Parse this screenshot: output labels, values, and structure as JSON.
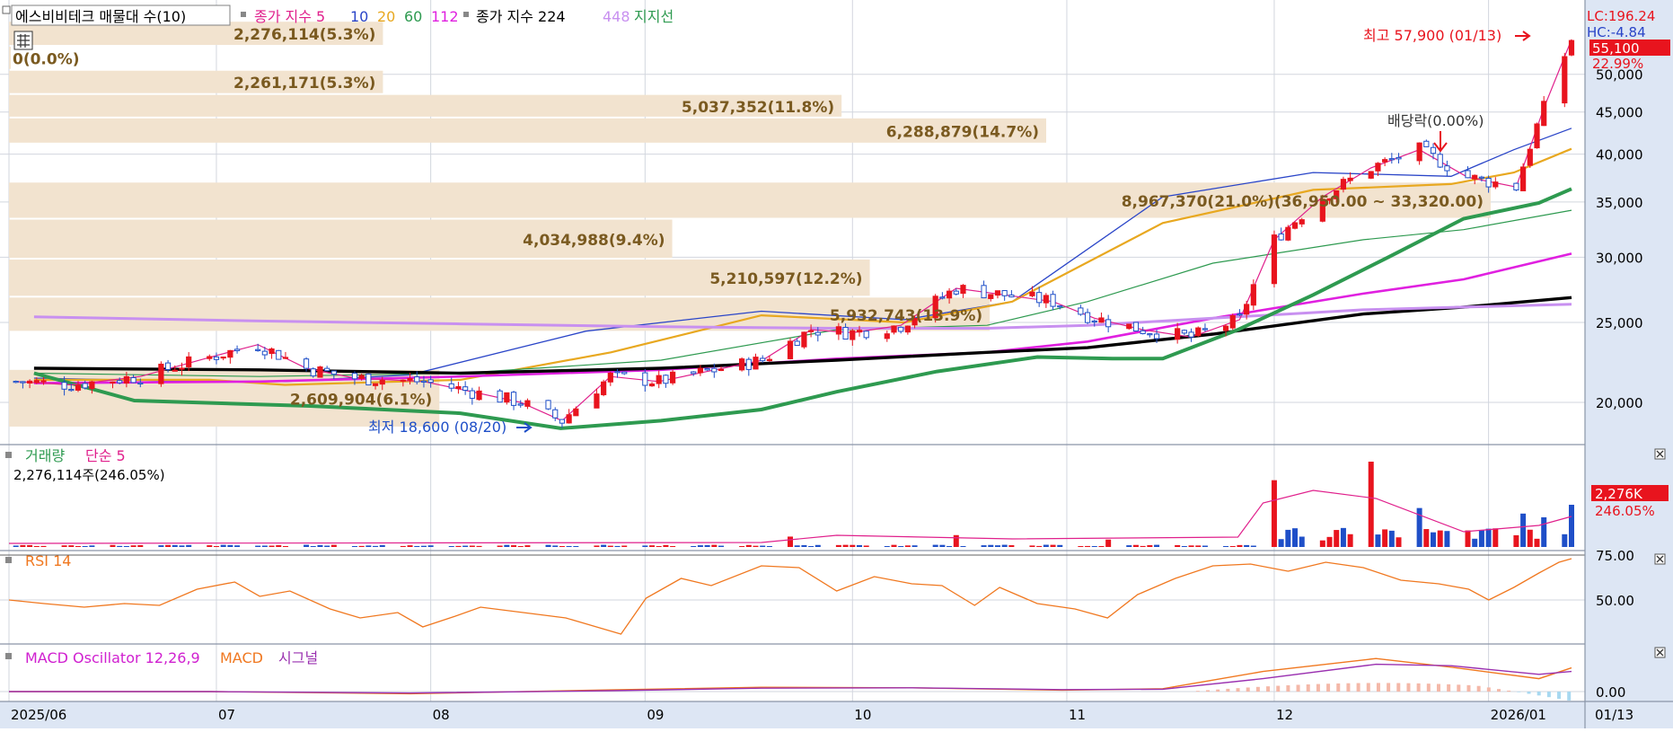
{
  "legend": {
    "title": "에스비비테크 매물대 수(10)",
    "ma_label": "종가 지수 5",
    "ma_periods": [
      "10",
      "20",
      "60",
      "112"
    ],
    "long_ma_label": "종가 지수 224",
    "long_ma_448": "448",
    "support_label": "지지선"
  },
  "indicators": {
    "lc": "LC:196.24",
    "hc": "HC:-4.84",
    "price_badge": "55,100",
    "pct_badge": "22.99%",
    "high_label": "최고 57,900 (01/13)",
    "low_label": "최저 18,600 (08/20)",
    "dividend_label": "배당락(0.00%)",
    "volume_title": "거래량",
    "volume_ma": "단순 5",
    "volume_value": "2,276,114주(246.05%)",
    "volume_badge": "2,276K",
    "volume_pct_badge": "246.05%",
    "rsi_title": "RSI 14",
    "macd_title": "MACD Oscillator 12,26,9",
    "macd_label": "MACD",
    "signal_label": "시그널",
    "last_date": "01/13"
  },
  "colors": {
    "up": "#e8141e",
    "down": "#1f4fc8",
    "ma5": "#e0208c",
    "ma10": "#2a45c8",
    "ma20": "#e8a820",
    "ma60": "#2e9a50",
    "ma112": "#e020e0",
    "ma224": "#000000",
    "ma448": "#c890f0",
    "support": "#2e9a50",
    "profile": "#f2e3cf",
    "profile_text": "#7a5a20",
    "rsi": "#f07820",
    "macd": "#f07820",
    "signal": "#9a30b0",
    "grid": "#d2d6de"
  },
  "chart_data": [
    {
      "type": "candlestick",
      "title": "에스비비테크 매물대 수(10)",
      "ylim": [
        18000,
        60000
      ],
      "y_scale": "log",
      "y_ticks": [
        "50,000",
        "45,000",
        "40,000",
        "35,000",
        "30,000",
        "25,000",
        "20,000"
      ],
      "x_ticks": [
        "2025/06",
        "07",
        "08",
        "09",
        "10",
        "11",
        "12",
        "2026/01",
        "01/13"
      ],
      "x_range": [
        "2025-06-01",
        "2026-01-13"
      ],
      "grid": true,
      "close_series": [
        [
          "2025-06-02",
          21200
        ],
        [
          "2025-06-10",
          21000
        ],
        [
          "2025-06-20",
          21500
        ],
        [
          "2025-07-01",
          22800
        ],
        [
          "2025-07-07",
          23500
        ],
        [
          "2025-07-14",
          22000
        ],
        [
          "2025-07-21",
          21400
        ],
        [
          "2025-07-31",
          21200
        ],
        [
          "2025-08-07",
          20600
        ],
        [
          "2025-08-14",
          20000
        ],
        [
          "2025-08-20",
          19000
        ],
        [
          "2025-08-27",
          21500
        ],
        [
          "2025-09-03",
          21200
        ],
        [
          "2025-09-10",
          21800
        ],
        [
          "2025-09-18",
          22500
        ],
        [
          "2025-09-25",
          24500
        ],
        [
          "2025-10-01",
          24300
        ],
        [
          "2025-10-08",
          24800
        ],
        [
          "2025-10-16",
          27500
        ],
        [
          "2025-10-23",
          27000
        ],
        [
          "2025-10-30",
          26500
        ],
        [
          "2025-11-05",
          25300
        ],
        [
          "2025-11-12",
          24500
        ],
        [
          "2025-11-19",
          24000
        ],
        [
          "2025-11-26",
          25200
        ],
        [
          "2025-12-01",
          31500
        ],
        [
          "2025-12-08",
          35500
        ],
        [
          "2025-12-15",
          38500
        ],
        [
          "2025-12-22",
          40500
        ],
        [
          "2025-12-29",
          37500
        ],
        [
          "2026-01-05",
          36500
        ],
        [
          "2026-01-09",
          45500
        ],
        [
          "2026-01-13",
          55100
        ]
      ],
      "moving_averages": [
        {
          "name": "10",
          "values": [
            [
              10,
              21400
            ],
            [
              80,
              21200
            ],
            [
              110,
              21200
            ],
            [
              160,
              21600
            ],
            [
              230,
              24400
            ],
            [
              300,
              25800
            ],
            [
              357,
              25200
            ],
            [
              400,
              26500
            ],
            [
              460,
              35500
            ],
            [
              520,
              38000
            ],
            [
              575,
              37600
            ],
            [
              600,
              40500
            ],
            [
              623,
              43000
            ]
          ]
        },
        {
          "name": "20",
          "values": [
            [
              10,
              21300
            ],
            [
              80,
              21300
            ],
            [
              110,
              21000
            ],
            [
              180,
              21300
            ],
            [
              240,
              23000
            ],
            [
              300,
              25500
            ],
            [
              357,
              25000
            ],
            [
              400,
              26500
            ],
            [
              460,
              33000
            ],
            [
              520,
              36200
            ],
            [
              575,
              36800
            ],
            [
              600,
              38000
            ],
            [
              623,
              40600
            ]
          ]
        },
        {
          "name": "60",
          "values": [
            [
              10,
              21700
            ],
            [
              100,
              21500
            ],
            [
              180,
              21700
            ],
            [
              260,
              22500
            ],
            [
              330,
              24500
            ],
            [
              390,
              24800
            ],
            [
              430,
              26500
            ],
            [
              480,
              29500
            ],
            [
              540,
              31500
            ],
            [
              580,
              32400
            ],
            [
              623,
              34200
            ]
          ]
        },
        {
          "name": "112",
          "values": [
            [
              10,
              21100
            ],
            [
              100,
              21200
            ],
            [
              180,
              21500
            ],
            [
              260,
              21900
            ],
            [
              330,
              22600
            ],
            [
              390,
              23000
            ],
            [
              430,
              23700
            ],
            [
              480,
              25300
            ],
            [
              540,
              27100
            ],
            [
              580,
              28200
            ],
            [
              623,
              30300
            ]
          ]
        },
        {
          "name": "224",
          "values": [
            [
              10,
              22000
            ],
            [
              100,
              21900
            ],
            [
              180,
              21700
            ],
            [
              260,
              22000
            ],
            [
              330,
              22500
            ],
            [
              390,
              23000
            ],
            [
              430,
              23300
            ],
            [
              480,
              24200
            ],
            [
              540,
              25600
            ],
            [
              580,
              26100
            ],
            [
              623,
              26800
            ]
          ]
        },
        {
          "name": "448",
          "values": [
            [
              10,
              25400
            ],
            [
              100,
              25100
            ],
            [
              180,
              24900
            ],
            [
              260,
              24700
            ],
            [
              330,
              24600
            ],
            [
              390,
              24600
            ],
            [
              430,
              24800
            ],
            [
              480,
              25300
            ],
            [
              540,
              25900
            ],
            [
              580,
              26100
            ],
            [
              623,
              26300
            ]
          ]
        }
      ],
      "support_line": [
        [
          10,
          21700
        ],
        [
          50,
          20100
        ],
        [
          120,
          19800
        ],
        [
          180,
          19400
        ],
        [
          220,
          18600
        ],
        [
          260,
          19000
        ],
        [
          300,
          19600
        ],
        [
          330,
          20600
        ],
        [
          370,
          21800
        ],
        [
          410,
          22700
        ],
        [
          440,
          22600
        ],
        [
          460,
          22600
        ],
        [
          490,
          24500
        ],
        [
          520,
          27000
        ],
        [
          550,
          30000
        ],
        [
          580,
          33400
        ],
        [
          610,
          34900
        ],
        [
          623,
          36300
        ]
      ],
      "volume_profile": [
        {
          "price_range": [
            57900,
            54000
          ],
          "value": "2,276,114",
          "share": "5.3%",
          "label": "2,276,114(5.3%)"
        },
        {
          "price_range": [
            54000,
            50500
          ],
          "value": "0",
          "share": "0.0%",
          "label": "0(0.0%)"
        },
        {
          "price_range": [
            50500,
            47200
          ],
          "value": "2,261,171",
          "share": "5.3%",
          "label": "2,261,171(5.3%)"
        },
        {
          "price_range": [
            47200,
            44200
          ],
          "value": "5,037,352",
          "share": "11.8%",
          "label": "5,037,352(11.8%)"
        },
        {
          "price_range": [
            44200,
            41100
          ],
          "value": "6,288,879",
          "share": "14.7%",
          "label": "6,288,879(14.7%)"
        },
        {
          "price_range": [
            36950,
            33320
          ],
          "value": "8,967,370",
          "share": "21.0%",
          "label": "8,967,370(21.0%)(36,950.00 ~ 33,320.00)"
        },
        {
          "price_range": [
            33320,
            29800
          ],
          "value": "4,034,988",
          "share": "9.4%",
          "label": "4,034,988(9.4%)"
        },
        {
          "price_range": [
            29800,
            26800
          ],
          "value": "5,210,597",
          "share": "12.2%",
          "label": "5,210,597(12.2%)"
        },
        {
          "price_range": [
            26800,
            24300
          ],
          "value": "5,932,743",
          "share": "13.9%",
          "label": "5,932,743(13.9%)"
        },
        {
          "price_range": [
            21900,
            18600
          ],
          "value": "2,609,904",
          "share": "6.1%",
          "label": "2,609,904(6.1%)"
        }
      ]
    },
    {
      "type": "bar",
      "title": "거래량",
      "series_name": "단순 5",
      "last_value": 2276114,
      "last_pct": "246.05%",
      "spikes": [
        {
          "date": "2025-09-22",
          "value": 560000
        },
        {
          "date": "2025-10-16",
          "value": 640000
        },
        {
          "date": "2025-11-07",
          "value": 400000
        },
        {
          "date": "2025-12-01",
          "value": 3600000
        },
        {
          "date": "2025-12-15",
          "value": 4600000
        },
        {
          "date": "2025-12-22",
          "value": 2100000
        },
        {
          "date": "2026-01-06",
          "value": 1800000
        },
        {
          "date": "2026-01-09",
          "value": 1600000
        },
        {
          "date": "2026-01-13",
          "value": 2276114
        }
      ]
    },
    {
      "type": "line",
      "title": "RSI 14",
      "y_ticks": [
        "75.00",
        "50.00"
      ],
      "ylim": [
        30,
        80
      ],
      "values": [
        [
          0,
          50
        ],
        [
          14,
          48
        ],
        [
          30,
          46
        ],
        [
          46,
          48
        ],
        [
          60,
          47
        ],
        [
          75,
          56
        ],
        [
          90,
          60
        ],
        [
          100,
          52
        ],
        [
          112,
          55
        ],
        [
          128,
          45
        ],
        [
          140,
          40
        ],
        [
          155,
          43
        ],
        [
          165,
          35
        ],
        [
          178,
          41
        ],
        [
          188,
          46
        ],
        [
          205,
          43
        ],
        [
          222,
          40
        ],
        [
          244,
          31
        ],
        [
          254,
          51
        ],
        [
          268,
          62
        ],
        [
          280,
          58
        ],
        [
          300,
          69
        ],
        [
          315,
          68
        ],
        [
          330,
          55
        ],
        [
          345,
          63
        ],
        [
          360,
          59
        ],
        [
          372,
          58
        ],
        [
          385,
          47
        ],
        [
          395,
          57
        ],
        [
          410,
          48
        ],
        [
          425,
          45
        ],
        [
          438,
          40
        ],
        [
          450,
          53
        ],
        [
          465,
          62
        ],
        [
          480,
          69
        ],
        [
          495,
          70
        ],
        [
          510,
          66
        ],
        [
          525,
          71
        ],
        [
          540,
          68
        ],
        [
          555,
          61
        ],
        [
          570,
          59
        ],
        [
          582,
          56
        ],
        [
          590,
          50
        ],
        [
          600,
          57
        ],
        [
          610,
          65
        ],
        [
          618,
          71
        ],
        [
          623,
          73
        ]
      ]
    },
    {
      "type": "line",
      "title": "MACD Oscillator 12,26,9",
      "y_ticks": [
        "0.00"
      ],
      "series": [
        {
          "name": "MACD",
          "values": [
            [
              0,
              0
            ],
            [
              80,
              0
            ],
            [
              160,
              -150
            ],
            [
              240,
              120
            ],
            [
              300,
              300
            ],
            [
              360,
              260
            ],
            [
              420,
              100
            ],
            [
              460,
              200
            ],
            [
              500,
              1400
            ],
            [
              545,
              2300
            ],
            [
              575,
              1700
            ],
            [
              610,
              900
            ],
            [
              623,
              1650
            ]
          ]
        },
        {
          "name": "시그널",
          "values": [
            [
              0,
              0
            ],
            [
              80,
              0
            ],
            [
              160,
              -100
            ],
            [
              240,
              60
            ],
            [
              300,
              240
            ],
            [
              360,
              260
            ],
            [
              420,
              140
            ],
            [
              460,
              160
            ],
            [
              500,
              900
            ],
            [
              545,
              1900
            ],
            [
              575,
              1800
            ],
            [
              610,
              1200
            ],
            [
              623,
              1400
            ]
          ]
        }
      ]
    }
  ]
}
